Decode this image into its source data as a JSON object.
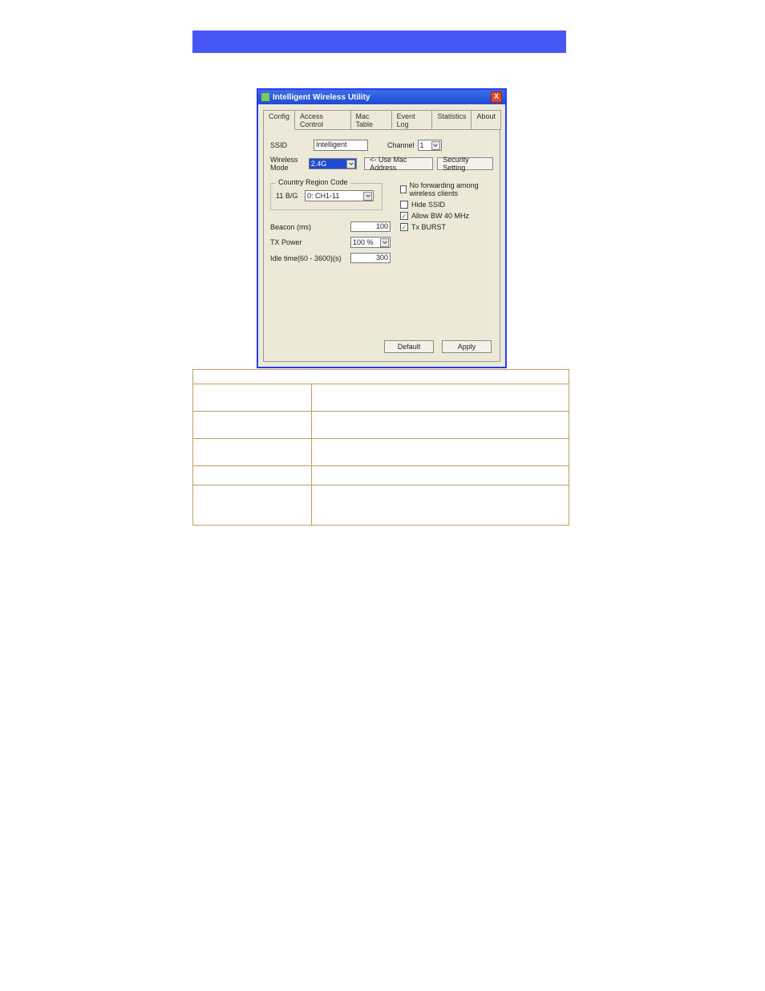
{
  "banner": {
    "text": ""
  },
  "window": {
    "title": "Intelligent Wireless Utility",
    "close_label": "X",
    "tabs": [
      {
        "label": "Config"
      },
      {
        "label": "Access Control"
      },
      {
        "label": "Mac Table"
      },
      {
        "label": "Event Log"
      },
      {
        "label": "Statistics"
      },
      {
        "label": "About"
      }
    ],
    "active_tab_index": 0,
    "config": {
      "ssid_label": "SSID",
      "ssid_value": "Intelligent",
      "channel_label": "Channel",
      "channel_value": "1",
      "wireless_mode_label": "Wireless Mode",
      "wireless_mode_value": "2.4G",
      "use_mac_button": "<- Use Mac Address",
      "security_button": "Security Setting",
      "region_legend": "Country Region Code",
      "region_11bg_label": "11 B/G",
      "region_11bg_value": "0: CH1-11",
      "checkboxes": {
        "no_forwarding": {
          "label": "No forwarding among wireless clients",
          "checked": false
        },
        "hide_ssid": {
          "label": "Hide SSID",
          "checked": false
        },
        "allow_bw40": {
          "label": "Allow BW 40 MHz",
          "checked": true
        },
        "tx_burst": {
          "label": "Tx BURST",
          "checked": true
        }
      },
      "beacon_label": "Beacon (ms)",
      "beacon_value": "100",
      "tx_power_label": "TX Power",
      "tx_power_value": "100 %",
      "idle_label": "Idle time(60 - 3600)(s)",
      "idle_value": "300",
      "default_button": "Default",
      "apply_button": "Apply"
    }
  },
  "desc_table": {
    "header": "",
    "rows": [
      {
        "c1": "",
        "c2": ""
      },
      {
        "c1": "",
        "c2": ""
      },
      {
        "c1": "",
        "c2": ""
      },
      {
        "c1": "",
        "c2": ""
      },
      {
        "c1": "",
        "c2": ""
      }
    ]
  }
}
